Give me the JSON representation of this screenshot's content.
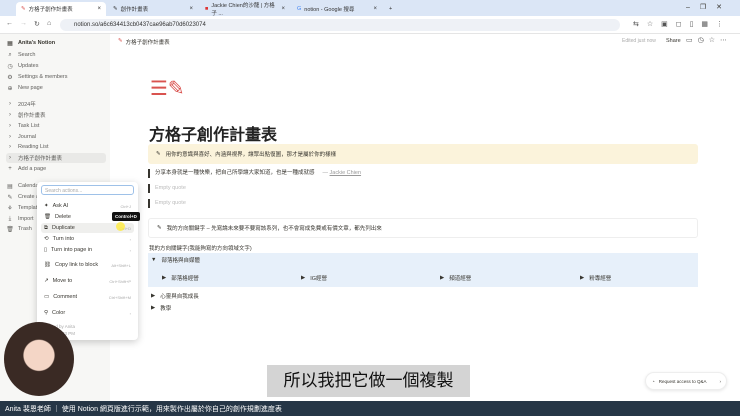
{
  "browser": {
    "tabs": [
      {
        "label": "方格子創作計畫表",
        "active": true
      },
      {
        "label": "創作計畫表"
      },
      {
        "label": "Jackie Chien的沙龍 | 方格子 ..."
      },
      {
        "label": "notion - Google 搜尋"
      }
    ],
    "new_tab": "+",
    "url": "notion.so/a6c634413cb0437cae96ab70d6023074"
  },
  "sidebar": {
    "workspace": "Anita's Notion",
    "top": [
      {
        "icon": "search-icon",
        "label": "Search"
      },
      {
        "icon": "clock-icon",
        "label": "Updates"
      },
      {
        "icon": "gear-icon",
        "label": "Settings & members"
      },
      {
        "icon": "plus-icon",
        "label": "New page"
      }
    ],
    "pages": [
      {
        "label": "2024年"
      },
      {
        "label": "創作計畫表"
      },
      {
        "label": "Task List"
      },
      {
        "label": "Journal"
      },
      {
        "label": "Reading List"
      },
      {
        "label": "方格子創作計畫表"
      }
    ],
    "add_page": "Add a page",
    "bottom": [
      {
        "label": "Calendar"
      },
      {
        "label": "Create a"
      },
      {
        "label": "Templates"
      },
      {
        "label": "Import"
      },
      {
        "label": "Trash"
      }
    ]
  },
  "topbar": {
    "breadcrumb": "方格子創作計畫表",
    "edited": "Edited just now",
    "share": "Share"
  },
  "menu": {
    "search_placeholder": "Search actions...",
    "items": [
      {
        "label": "Ask AI",
        "shortcut": "Ctrl+J"
      },
      {
        "label": "Delete",
        "shortcut": "Del"
      },
      {
        "label": "Duplicate",
        "shortcut": "Ctrl+D"
      },
      {
        "label": "Turn into",
        "shortcut": "›"
      },
      {
        "label": "Turn into page in",
        "shortcut": "›"
      },
      {
        "label": "Copy link to block",
        "shortcut": "Alt+Shift+L"
      },
      {
        "label": "Move to",
        "shortcut": "Ctrl+Shift+P"
      },
      {
        "label": "Comment",
        "shortcut": "Ctrl+Shift+M"
      },
      {
        "label": "Color",
        "shortcut": "›"
      }
    ],
    "footer1": "Edited by Anita",
    "footer2": "Today 7:33 PM",
    "tooltip": "Control+D"
  },
  "page": {
    "title": "方格子創作計畫表",
    "callout1": "用你的意識與喜好、內涵與視界，讓眾出點復圖，那才是屬於你的樣樣",
    "quote": "分享本身就是一種快樂，把自己所學讓大家知道，也是一種成就感",
    "quote_author_prefix": "— ",
    "quote_author": "Jackie Chien",
    "empty_quote": "Empty quote",
    "callout2": "我的方向關鍵字 – 先寫論未來要不要寫該系列，也不會寫成免費或有價文章，都先列出來",
    "heading": "我的方向關鍵字(我能夠寫的方向領域文字)",
    "toggle1": "部落格與自媒體",
    "sub_toggles": [
      "部落格經營",
      "IG經營",
      "頻道經營",
      "粉專經營"
    ],
    "toggle2": "心靈與自我成長",
    "toggle3": "教學"
  },
  "video": {
    "subtitle": "所以我把它做一個複製",
    "caption": "Anita 裴恩老師 ｜ 使用 Notion 網頁版進行示範，用來製作出屬於你自己的創作規劃進度表",
    "qa": "Request access to Q&A"
  },
  "colors": {
    "callout_yellow": "#fbf3db",
    "toggle_blue": "#e7f0fa",
    "accent": "#d9534f"
  }
}
